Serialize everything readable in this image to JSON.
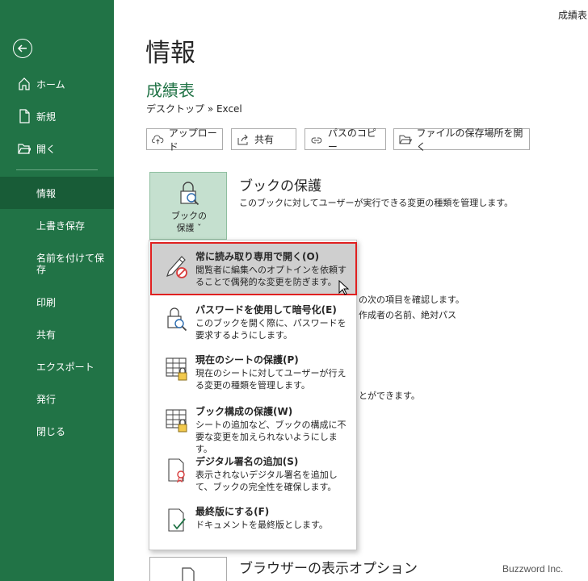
{
  "window": {
    "title": "成績表..."
  },
  "sidebar": {
    "items": [
      {
        "label": "ホーム"
      },
      {
        "label": "新規"
      },
      {
        "label": "開く"
      },
      {
        "label": "情報"
      },
      {
        "label": "上書き保存"
      },
      {
        "label": "名前を付けて保存"
      },
      {
        "label": "印刷"
      },
      {
        "label": "共有"
      },
      {
        "label": "エクスポート"
      },
      {
        "label": "発行"
      },
      {
        "label": "閉じる"
      }
    ]
  },
  "main": {
    "title": "情報",
    "file_name": "成績表",
    "file_path": "デスクトップ » Excel",
    "toolbar": {
      "upload": "アップロード",
      "share": "共有",
      "copy_path": "パスのコピー",
      "open_location": "ファイルの保存場所を開く"
    },
    "protect": {
      "tile_label_1": "ブックの",
      "tile_label_2": "保護 ˇ",
      "heading": "ブックの保護",
      "description": "このブックに対してユーザーが実行できる変更の種類を管理します。"
    },
    "inspect_partial_1": "の次の項目を確認します。",
    "inspect_partial_2": "作成者の名前、絶対パス",
    "versions_partial": "とができます。",
    "browser_heading": "ブラウザーの表示オプション"
  },
  "menu": {
    "items": [
      {
        "title": "常に読み取り専用で開く(O)",
        "desc": "閲覧者に編集へのオプトインを依頼することで偶発的な変更を防ぎます。"
      },
      {
        "title": "パスワードを使用して暗号化(E)",
        "desc": "このブックを開く際に、パスワードを要求するようにします。"
      },
      {
        "title": "現在のシートの保護(P)",
        "desc": "現在のシートに対してユーザーが行える変更の種類を管理します。"
      },
      {
        "title": "ブック構成の保護(W)",
        "desc": "シートの追加など、ブックの構成に不要な変更を加えられないようにします。"
      },
      {
        "title": "デジタル署名の追加(S)",
        "desc": "表示されないデジタル署名を追加して、ブックの完全性を確保します。"
      },
      {
        "title": "最終版にする(F)",
        "desc": "ドキュメントを最終版とします。"
      }
    ]
  },
  "watermark": "Buzzword Inc.",
  "colors": {
    "accent": "#217346",
    "active": "#185c37",
    "highlight_border": "#e02020"
  }
}
